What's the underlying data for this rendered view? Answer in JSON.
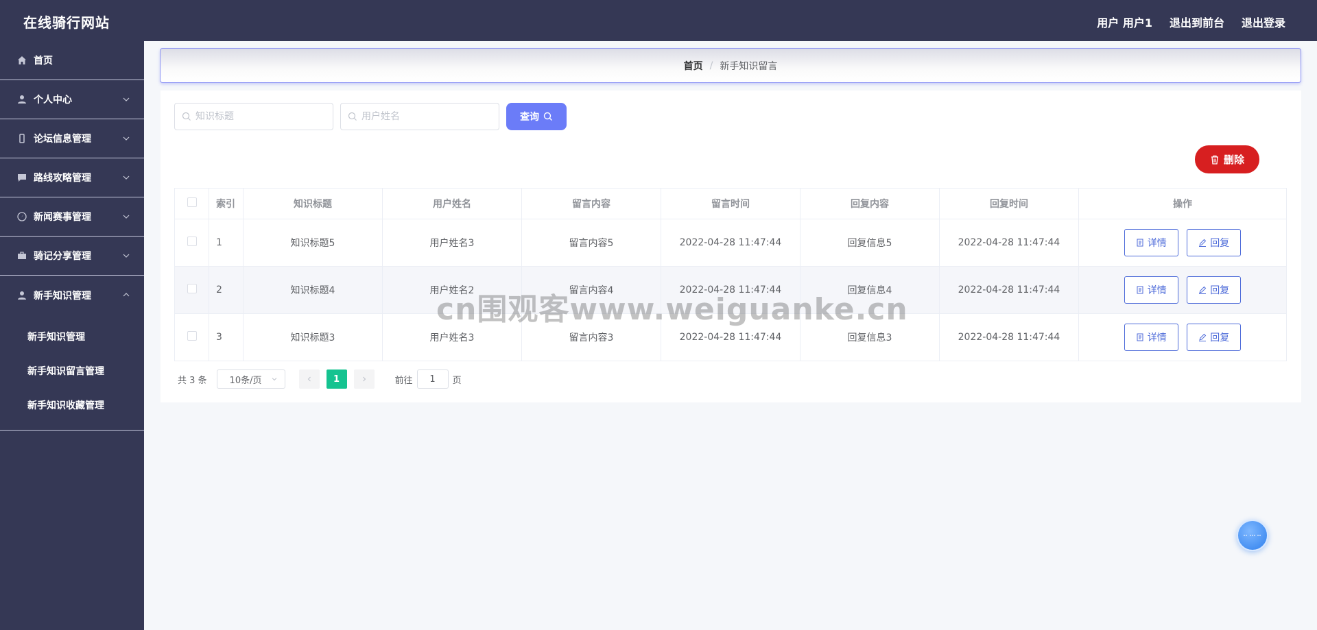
{
  "header": {
    "site_title": "在线骑行网站",
    "user_label": "用户 用户1",
    "back_frontend": "退出到前台",
    "logout": "退出登录"
  },
  "sidebar": {
    "items": [
      {
        "label": "首页",
        "icon": "home-icon"
      },
      {
        "label": "个人中心",
        "icon": "user-icon"
      },
      {
        "label": "论坛信息管理",
        "icon": "phone-icon"
      },
      {
        "label": "路线攻略管理",
        "icon": "chat-icon"
      },
      {
        "label": "新闻赛事管理",
        "icon": "compass-icon"
      },
      {
        "label": "骑记分享管理",
        "icon": "briefcase-icon"
      },
      {
        "label": "新手知识管理",
        "icon": "user-icon"
      }
    ],
    "subitems": [
      "新手知识管理",
      "新手知识留言管理",
      "新手知识收藏管理"
    ]
  },
  "breadcrumb": {
    "home": "首页",
    "separator": "/",
    "current": "新手知识留言"
  },
  "search": {
    "title_placeholder": "知识标题",
    "name_placeholder": "用户姓名",
    "query_label": "查询"
  },
  "delete_label": "删除",
  "table": {
    "headers": [
      "索引",
      "知识标题",
      "用户姓名",
      "留言内容",
      "留言时间",
      "回复内容",
      "回复时间",
      "操作"
    ],
    "rows": [
      {
        "index": "1",
        "title": "知识标题5",
        "name": "用户姓名3",
        "content": "留言内容5",
        "time": "2022-04-28 11:47:44",
        "reply": "回复信息5",
        "reply_time": "2022-04-28 11:47:44"
      },
      {
        "index": "2",
        "title": "知识标题4",
        "name": "用户姓名2",
        "content": "留言内容4",
        "time": "2022-04-28 11:47:44",
        "reply": "回复信息4",
        "reply_time": "2022-04-28 11:47:44"
      },
      {
        "index": "3",
        "title": "知识标题3",
        "name": "用户姓名3",
        "content": "留言内容3",
        "time": "2022-04-28 11:47:44",
        "reply": "回复信息3",
        "reply_time": "2022-04-28 11:47:44"
      }
    ],
    "detail_label": "详情",
    "reply_label": "回复"
  },
  "pagination": {
    "total": "共 3 条",
    "page_size": "10条/页",
    "current_page": "1",
    "goto_prefix": "前往",
    "goto_value": "1",
    "goto_suffix": "页"
  },
  "watermark": "cn围观客www.weiguanke.cn",
  "colors": {
    "nav_bg": "#353855",
    "primary": "#6b7cf8",
    "danger": "#d71f20",
    "page_active": "#15c390",
    "link": "#4c6ad9"
  }
}
